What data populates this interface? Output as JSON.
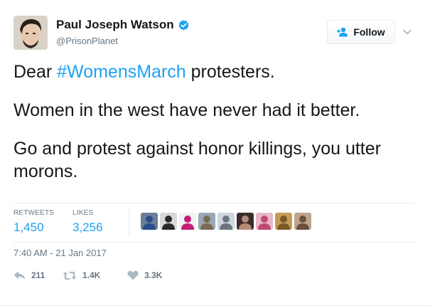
{
  "author": {
    "display_name": "Paul Joseph Watson",
    "handle": "@PrisonPlanet",
    "verified": true
  },
  "follow_button": {
    "label": "Follow"
  },
  "tweet": {
    "line1_prefix": "Dear ",
    "hashtag": "#WomensMarch",
    "line1_suffix": " protesters.",
    "line2": "Women in the west have never had it better.",
    "line3": "Go and protest against honor killings, you utter morons."
  },
  "stats": {
    "retweets_label": "RETWEETS",
    "retweets_value": "1,450",
    "likes_label": "LIKES",
    "likes_value": "3,256",
    "liker_avatars": [
      {
        "bg": "#6b7f99",
        "fg": "#2b4d8c"
      },
      {
        "bg": "#d9d9d9",
        "fg": "#2a2a2a"
      },
      {
        "bg": "#f2f2f2",
        "fg": "#c0207a"
      },
      {
        "bg": "#9aa7b5",
        "fg": "#7a6a55"
      },
      {
        "bg": "#cfd6de",
        "fg": "#6d7680"
      },
      {
        "bg": "#3d2b2b",
        "fg": "#b58b78"
      },
      {
        "bg": "#e8b7c8",
        "fg": "#c04a6e"
      },
      {
        "bg": "#c79a58",
        "fg": "#7a5a2a"
      },
      {
        "bg": "#bfa48c",
        "fg": "#6a4f3c"
      }
    ]
  },
  "timestamp": "7:40 AM - 21 Jan 2017",
  "actions": {
    "reply_count": "211",
    "retweet_count": "1.4K",
    "like_count": "3.3K"
  },
  "colors": {
    "accent": "#1da1f2",
    "muted": "#657786",
    "text": "#14171a",
    "divider": "#e6ecf0"
  },
  "footer": {
    "bottom_line": ""
  }
}
